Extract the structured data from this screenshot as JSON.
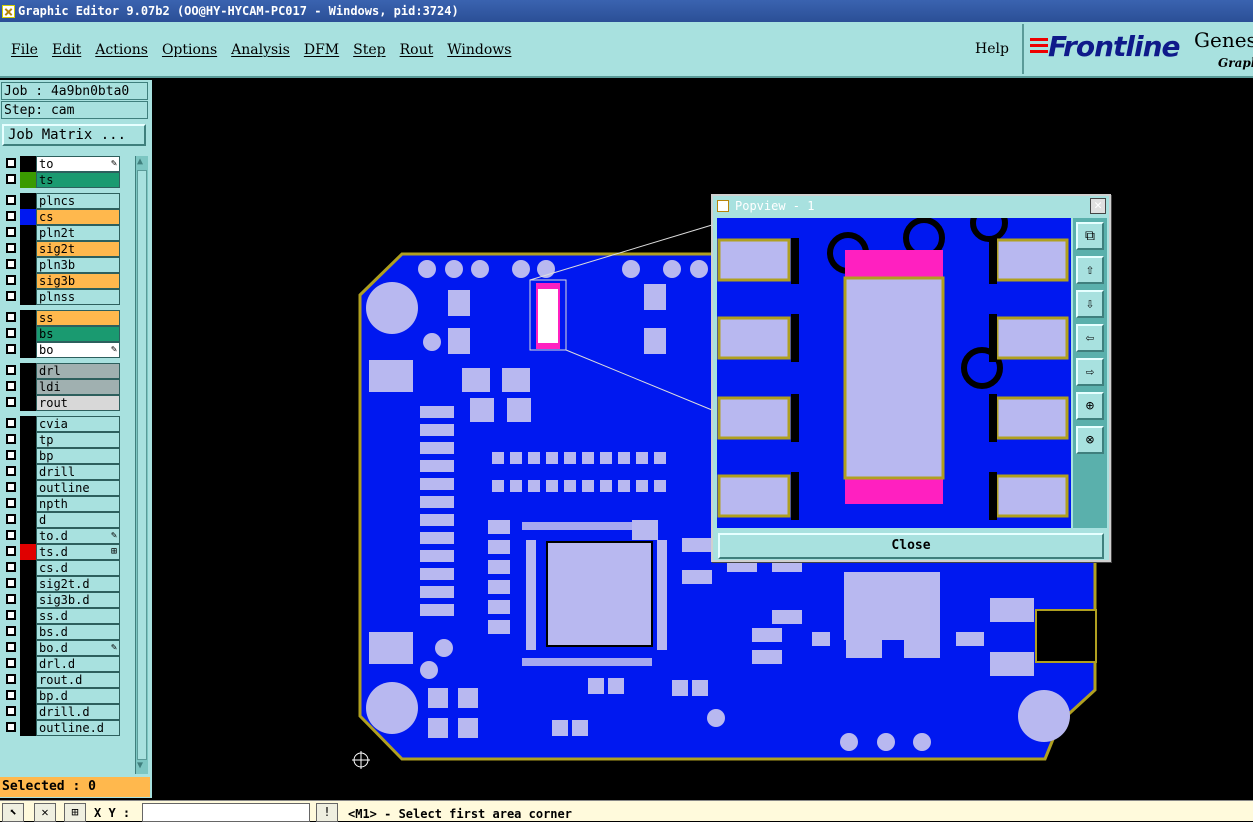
{
  "window": {
    "title": "Graphic Editor 9.07b2 (OO@HY-HYCAM-PC017 - Windows, pid:3724)"
  },
  "menu": {
    "items": [
      "File",
      "Edit",
      "Actions",
      "Options",
      "Analysis",
      "DFM",
      "Step",
      "Rout",
      "Windows"
    ],
    "help": "Help"
  },
  "logo": {
    "brand": "Frontline",
    "product": "Genes",
    "sub": "Graph"
  },
  "left": {
    "job": "Job : 4a9bn0bta0",
    "step": "Step: cam",
    "job_matrix": "Job Matrix ..."
  },
  "layers": [
    {
      "name": "to",
      "bg": "#ffffff",
      "swatch": "#000000",
      "mark": "✎"
    },
    {
      "name": "ts",
      "bg": "#1a9a70",
      "swatch": "#3a9a00",
      "mark": ""
    },
    {
      "name": "plncs",
      "bg": "#a8e1df",
      "swatch": "#000000",
      "mark": ""
    },
    {
      "name": "cs",
      "bg": "#ffb84d",
      "swatch": "#0018f0",
      "mark": ""
    },
    {
      "name": "pln2t",
      "bg": "#a8e1df",
      "swatch": "#000000",
      "mark": ""
    },
    {
      "name": "sig2t",
      "bg": "#ffb84d",
      "swatch": "#000000",
      "mark": ""
    },
    {
      "name": "pln3b",
      "bg": "#a8e1df",
      "swatch": "#000000",
      "mark": ""
    },
    {
      "name": "sig3b",
      "bg": "#ffb84d",
      "swatch": "#000000",
      "mark": ""
    },
    {
      "name": "plnss",
      "bg": "#a8e1df",
      "swatch": "#000000",
      "mark": ""
    },
    {
      "name": "ss",
      "bg": "#ffb84d",
      "swatch": "#000000",
      "mark": ""
    },
    {
      "name": "bs",
      "bg": "#1a9a70",
      "swatch": "#000000",
      "mark": ""
    },
    {
      "name": "bo",
      "bg": "#ffffff",
      "swatch": "#000000",
      "mark": "✎"
    },
    {
      "name": "drl",
      "bg": "#a0b0b0",
      "swatch": "#000000",
      "mark": ""
    },
    {
      "name": "ldi",
      "bg": "#a0b0b0",
      "swatch": "#000000",
      "mark": ""
    },
    {
      "name": "rout",
      "bg": "#d8d8d8",
      "swatch": "#000000",
      "mark": ""
    },
    {
      "name": "cvia",
      "bg": "#a8e1df",
      "swatch": "#000000",
      "mark": ""
    },
    {
      "name": "tp",
      "bg": "#a8e1df",
      "swatch": "#000000",
      "mark": ""
    },
    {
      "name": "bp",
      "bg": "#a8e1df",
      "swatch": "#000000",
      "mark": ""
    },
    {
      "name": "drill",
      "bg": "#a8e1df",
      "swatch": "#000000",
      "mark": ""
    },
    {
      "name": "outline",
      "bg": "#a8e1df",
      "swatch": "#000000",
      "mark": ""
    },
    {
      "name": "npth",
      "bg": "#a8e1df",
      "swatch": "#000000",
      "mark": ""
    },
    {
      "name": "d",
      "bg": "#a8e1df",
      "swatch": "#000000",
      "mark": ""
    },
    {
      "name": "to.d",
      "bg": "#a8e1df",
      "swatch": "#000000",
      "mark": "✎"
    },
    {
      "name": "ts.d",
      "bg": "#a8e1df",
      "swatch": "#e00000",
      "mark": "⊞"
    },
    {
      "name": "cs.d",
      "bg": "#a8e1df",
      "swatch": "#000000",
      "mark": ""
    },
    {
      "name": "sig2t.d",
      "bg": "#a8e1df",
      "swatch": "#000000",
      "mark": ""
    },
    {
      "name": "sig3b.d",
      "bg": "#a8e1df",
      "swatch": "#000000",
      "mark": ""
    },
    {
      "name": "ss.d",
      "bg": "#a8e1df",
      "swatch": "#000000",
      "mark": ""
    },
    {
      "name": "bs.d",
      "bg": "#a8e1df",
      "swatch": "#000000",
      "mark": ""
    },
    {
      "name": "bo.d",
      "bg": "#a8e1df",
      "swatch": "#000000",
      "mark": "✎"
    },
    {
      "name": "drl.d",
      "bg": "#a8e1df",
      "swatch": "#000000",
      "mark": ""
    },
    {
      "name": "rout.d",
      "bg": "#a8e1df",
      "swatch": "#000000",
      "mark": ""
    },
    {
      "name": "bp.d",
      "bg": "#a8e1df",
      "swatch": "#000000",
      "mark": ""
    },
    {
      "name": "drill.d",
      "bg": "#a8e1df",
      "swatch": "#000000",
      "mark": ""
    },
    {
      "name": "outline.d",
      "bg": "#a8e1df",
      "swatch": "#000000",
      "mark": ""
    }
  ],
  "selected": "Selected : 0",
  "status": {
    "xy_label": "X Y :",
    "xy_value": "",
    "message": "<M1> - Select first area corner"
  },
  "popview": {
    "title": "Popview - 1",
    "close_label": "Close"
  },
  "colors": {
    "panel": "#a8e1df",
    "board": "#0018f0",
    "pad": "#b8b8f0",
    "selection": "#ff20c0",
    "outline": "#b0a020"
  }
}
